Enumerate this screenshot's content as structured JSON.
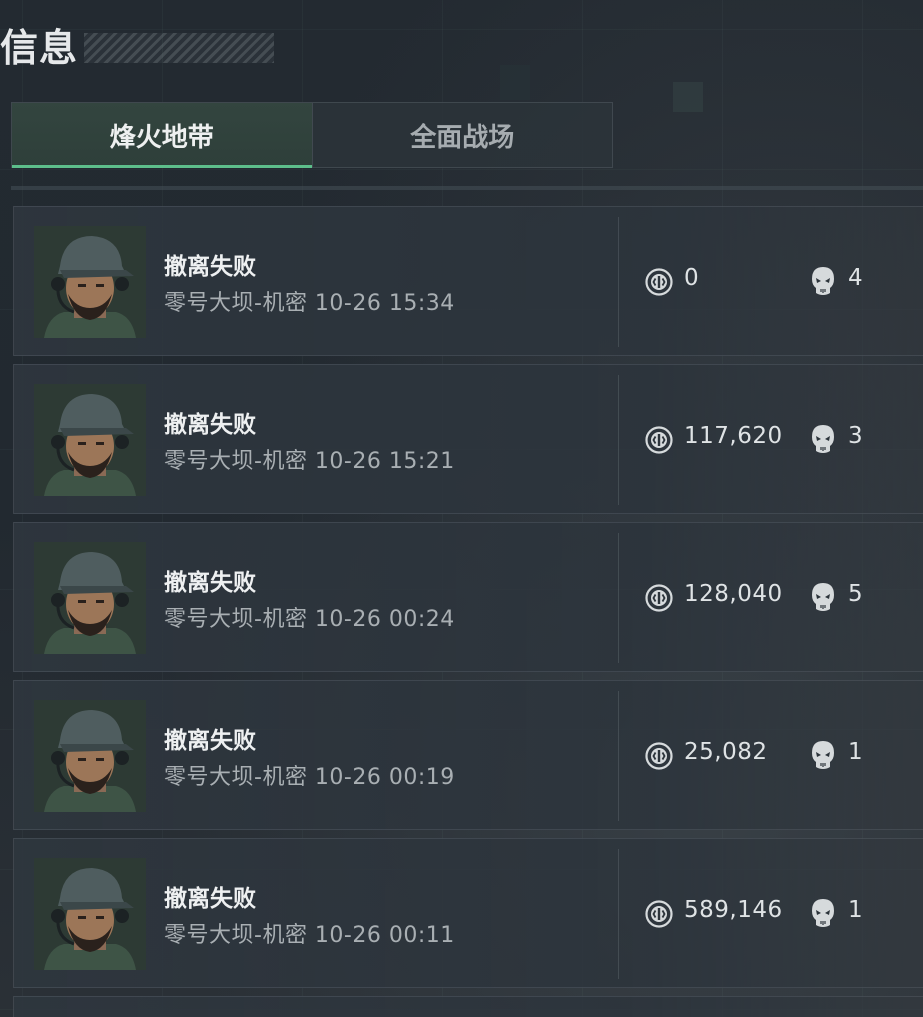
{
  "page": {
    "title": "信息"
  },
  "tabs": [
    {
      "label": "烽火地带",
      "active": true
    },
    {
      "label": "全面战场",
      "active": false
    }
  ],
  "records": [
    {
      "status": "撤离失败",
      "detail": "零号大坝-机密 10-26 15:34",
      "coins": "0",
      "kills": "4"
    },
    {
      "status": "撤离失败",
      "detail": "零号大坝-机密 10-26 15:21",
      "coins": "117,620",
      "kills": "3"
    },
    {
      "status": "撤离失败",
      "detail": "零号大坝-机密 10-26 00:24",
      "coins": "128,040",
      "kills": "5"
    },
    {
      "status": "撤离失败",
      "detail": "零号大坝-机密 10-26 00:19",
      "coins": "25,082",
      "kills": "1"
    },
    {
      "status": "撤离失败",
      "detail": "零号大坝-机密 10-26 00:11",
      "coins": "589,146",
      "kills": "1"
    }
  ],
  "icons": {
    "coin": "coin-icon",
    "skull": "skull-icon"
  },
  "colors": {
    "accent": "#5dbf8b",
    "tab_active_bg": "#33453f"
  }
}
